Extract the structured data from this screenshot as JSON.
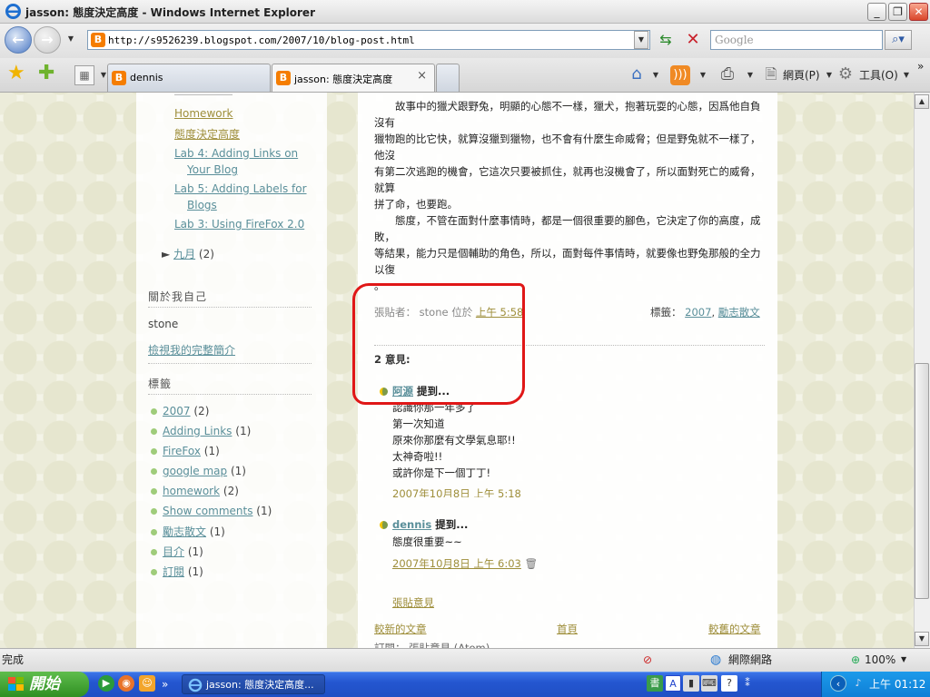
{
  "window": {
    "title": "jasson: 態度決定高度 - Windows Internet Explorer",
    "buttons": [
      "_",
      "❐",
      "✕"
    ]
  },
  "navbar": {
    "back_icon": "back-arrow-icon",
    "forward_icon": "forward-arrow-icon",
    "url": "http://s9526239.blogspot.com/2007/10/blog-post.html",
    "search_placeholder": "Google"
  },
  "tabs": [
    {
      "label": "dennis",
      "active": false
    },
    {
      "label": "jasson: 態度決定高度",
      "active": true,
      "close": "×"
    }
  ],
  "commandbar": {
    "page_label": "網頁(P)",
    "tools_label": "工具(O)",
    "more": "»"
  },
  "sidebar": {
    "archive_links": [
      {
        "text": "Homework"
      },
      {
        "text": "態度決定高度",
        "style": "olive"
      },
      {
        "text": "Lab 4: Adding Links on",
        "text2": "Your Blog"
      },
      {
        "text": "Lab 5: Adding Labels for",
        "text2": "Blogs"
      },
      {
        "text": "Lab 3: Using FireFox 2.0"
      }
    ],
    "month": {
      "arrow": "►",
      "label": "九月",
      "count": "(2)"
    },
    "about": {
      "heading": "關於我自己",
      "name": "stone",
      "profile_link": "檢視我的完整簡介"
    },
    "labels_heading": "標籤",
    "labels": [
      {
        "name": "2007",
        "count": "(2)"
      },
      {
        "name": "Adding Links",
        "count": "(1)"
      },
      {
        "name": "FireFox",
        "count": "(1)"
      },
      {
        "name": "google map",
        "count": "(1)"
      },
      {
        "name": "homework",
        "count": "(2)"
      },
      {
        "name": "Show comments",
        "count": "(1)"
      },
      {
        "name": "勵志散文",
        "count": "(1)"
      },
      {
        "name": "目介",
        "count": "(1)"
      },
      {
        "name": "訂閱",
        "count": "(1)"
      }
    ]
  },
  "post": {
    "lines": [
      "　　故事中的獵犬跟野兔，明顯的心態不一樣，獵犬，抱著玩耍的心態，因爲他自負沒有",
      "獵物跑的比它快，就算沒獵到獵物，也不會有什麼生命威脅；但是野兔就不一樣了，他沒",
      "有第二次逃跑的機會，它這次只要被抓住，就再也沒機會了，所以面對死亡的威脅，就算",
      "拼了命，也要跑。",
      "　　態度，不管在面對什麼事情時，都是一個很重要的腳色，它決定了你的高度，成敗，",
      "等結果，能力只是個輔助的角色，所以，面對每件事情時，就要像也野兔那般的全力以復",
      "。"
    ],
    "footer": {
      "posted_by": "張貼者：",
      "author": "stone",
      "at": "位於",
      "time": "上午 5:58",
      "labels_prefix": "標籤：",
      "label1": "2007",
      "sep": ",",
      "label2": "勵志散文"
    }
  },
  "comments": {
    "heading": "2 意見:",
    "items": [
      {
        "author": "阿源",
        "said": "提到...",
        "lines": [
          "認識你那一年多了",
          "第一次知道",
          "原來你那麼有文學氣息耶!!",
          "太神奇啦!!",
          "或許你是下一個丁丁!"
        ],
        "timestamp": "2007年10月8日 上午 5:18"
      },
      {
        "author": "dennis",
        "said": "提到...",
        "lines": [
          "態度很重要~~"
        ],
        "timestamp": "2007年10月8日 上午 6:03",
        "delete_icon": "trash-icon"
      }
    ],
    "post_comment": "張貼意見"
  },
  "pager": {
    "newer": "較新的文章",
    "home": "首頁",
    "older": "較舊的文章",
    "subscribe_partial": "訂閱： 張貼意見 (Atom)"
  },
  "status": {
    "text": "完成",
    "zone": "網際網路",
    "zoom": "100%"
  },
  "taskbar": {
    "start": "開始",
    "window_item": "jasson: 態度決定高度...",
    "ime": "A",
    "clock": "上午 01:12",
    "more": "»"
  },
  "colors": {
    "link_teal": "#5a8f9a",
    "link_olive": "#9e8e3a",
    "highlight_red": "#e01717",
    "taskbar_blue": "#2456d0"
  }
}
